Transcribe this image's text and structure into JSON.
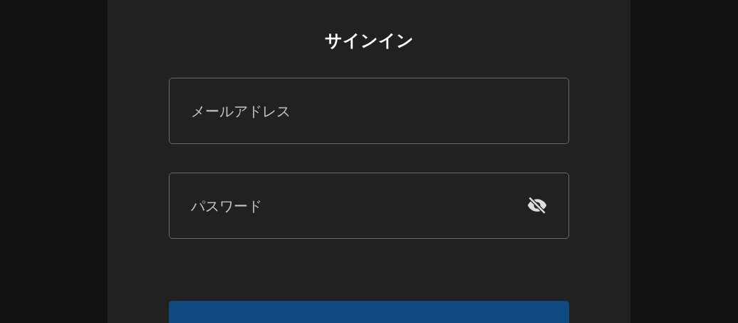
{
  "title": "サインイン",
  "fields": [
    {
      "kind": "email",
      "placeholder": "メールアドレス"
    },
    {
      "kind": "password",
      "placeholder": "パスワード",
      "revealed": false
    }
  ],
  "submit_button": {
    "kind": "primary"
  }
}
